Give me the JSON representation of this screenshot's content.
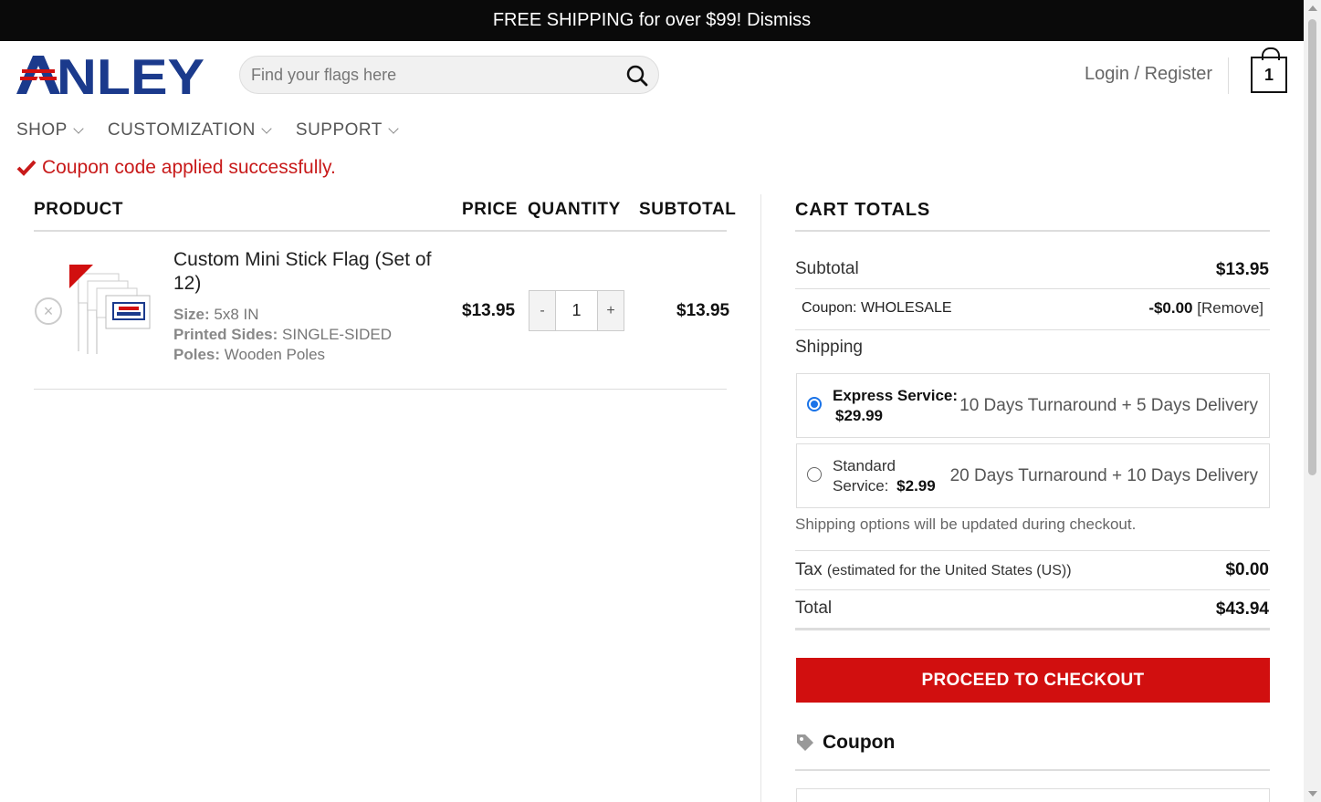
{
  "topbar": {
    "message": "FREE SHIPPING for over $99!",
    "dismiss_label": "Dismiss"
  },
  "header": {
    "logo_text": "ANLEY",
    "search_placeholder": "Find your flags here",
    "login_label": "Login / Register",
    "cart_count": "1"
  },
  "nav": {
    "items": [
      {
        "label": "SHOP"
      },
      {
        "label": "CUSTOMIZATION"
      },
      {
        "label": "SUPPORT"
      }
    ]
  },
  "notice": {
    "message": "Coupon code applied successfully."
  },
  "table": {
    "headers": {
      "product": "PRODUCT",
      "price": "PRICE",
      "quantity": "QUANTITY",
      "subtotal": "SUBTOTAL"
    },
    "rows": [
      {
        "name": "Custom Mini Stick Flag (Set of 12)",
        "meta": [
          {
            "key": "Size:",
            "value": "5x8 IN"
          },
          {
            "key": "Printed Sides:",
            "value": "SINGLE-SIDED"
          },
          {
            "key": "Poles:",
            "value": "Wooden Poles"
          }
        ],
        "price": "$13.95",
        "qty_minus": "-",
        "quantity": "1",
        "qty_plus": "+",
        "subtotal": "$13.95"
      }
    ]
  },
  "cart_totals": {
    "title": "CART TOTALS",
    "subtotal_label": "Subtotal",
    "subtotal_value": "$13.95",
    "coupon_label": "Coupon: WHOLESALE",
    "coupon_discount": "-$0.00",
    "coupon_remove": "[Remove]",
    "shipping_label": "Shipping",
    "shipping_options": [
      {
        "name": "Express Service:",
        "price": "$29.99",
        "description": "10 Days Turnaround + 5 Days Delivery",
        "selected": true
      },
      {
        "name": "Standard Service:",
        "name_line1": "Standard",
        "name_line2": "Service:",
        "price": "$2.99",
        "description": "20 Days Turnaround + 10 Days Delivery",
        "selected": false
      }
    ],
    "shipping_note": "Shipping options will be updated during checkout.",
    "tax_label": "Tax",
    "tax_note": "(estimated for the United States (US))",
    "tax_value": "$0.00",
    "total_label": "Total",
    "total_value": "$43.94",
    "checkout_label": "PROCEED TO CHECKOUT",
    "coupon_heading": "Coupon"
  },
  "colors": {
    "accent_red": "#d10f0f",
    "brand_navy": "#1b3a8c",
    "radio_blue": "#1a73e8",
    "topbar_bg": "#0a0a0a"
  },
  "icons": [
    "search-icon",
    "cart-icon",
    "chevron-down-icon",
    "checkmark-icon",
    "remove-icon",
    "tag-icon"
  ]
}
